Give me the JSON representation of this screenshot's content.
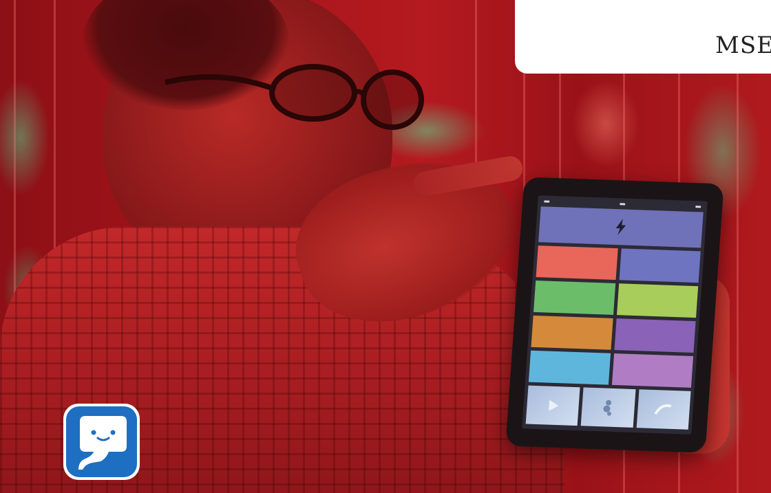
{
  "photo": {
    "description_icon": "photo-background",
    "accent_red": "#b41a20",
    "accent_green": "#5ad08c"
  },
  "overlay": {
    "brand_label": "MSE"
  },
  "tablet": {
    "top_tile_icon": "lightning-bolt-icon",
    "top_tile_color": "#6f72b8",
    "tiles": [
      [
        "#e8665a",
        "#6e74c0"
      ],
      [
        "#6bbd6a",
        "#a8cd5a"
      ],
      [
        "#d48a3a",
        "#8a62b8"
      ],
      [
        "#5fb6dc",
        "#b07cc4"
      ]
    ],
    "controls": [
      "play-icon",
      "bubbles-icon",
      "wave-icon"
    ]
  },
  "app_icon": {
    "icon_name": "smiling-genie-icon",
    "color": "#1e6fc2"
  }
}
